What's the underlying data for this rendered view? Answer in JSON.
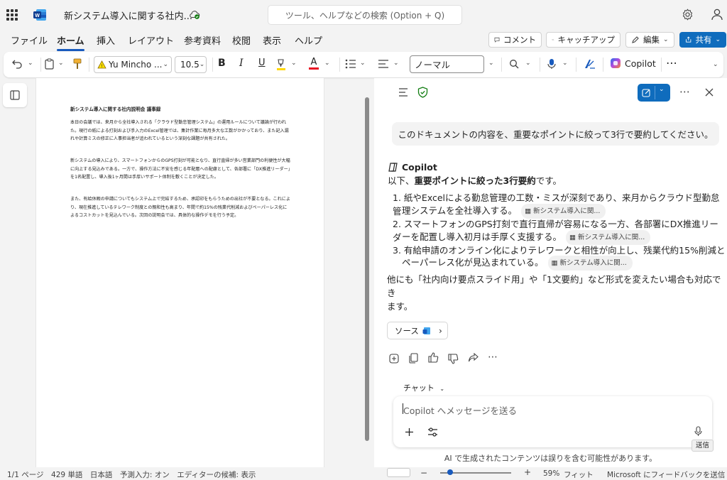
{
  "titlebar": {
    "doc_title": "新システム導入に関する社内...",
    "search_placeholder": "ツール、ヘルプなどの検索 (Option + Q)"
  },
  "menu": {
    "tabs": [
      "ファイル",
      "ホーム",
      "挿入",
      "レイアウト",
      "参考資料",
      "校閲",
      "表示",
      "ヘルプ"
    ],
    "active": "ホーム",
    "comment_label": "コメント",
    "catchup_label": "キャッチアップ",
    "edit_label": "編集",
    "share_label": "共有"
  },
  "ribbon": {
    "font_name": "Yu Mincho ...",
    "font_size": "10.5",
    "style_name": "ノーマル",
    "copilot_label": "Copilot",
    "bold_glyph": "B",
    "italic_glyph": "I",
    "underline_glyph": "U",
    "font_color_glyph": "A"
  },
  "document": {
    "heading": "新システム導入に関する社内説明会 議事録",
    "paragraphs": [
      "本日の会議では、来月から全社導入される「クラウド型勤怠管理システム」の運用ルールについて議論が行われた。現行の紙による打刻および手入力のExcel管理では、集計作業に毎月多大な工数がかかっており、また記入漏れや計算ミスの修正に人事担当者が追われているという深刻な課題が共有された。",
      "新システムの導入により、スマートフォンからのGPS打刻が可能となり、直行直帰が多い営業部門の利便性が大幅に向上する見込みである。一方で、操作方法に不安を感じる年配層への配慮として、各部署に「DX推進リーダー」を1名配置し、導入後1ヶ月間は手厚いサポート体制を敷くことが決定した。",
      "また、有給休暇の申請についてもシステム上で完結するため、承認印をもらうための出社が不要となる。これにより、現在推進しているテレワーク制度との親和性も高まり、年間で約15%の残業代削減およびペーパーレス化によるコストカットを見込んでいる。次回の説明会では、具体的な操作デモを行う予定。"
    ]
  },
  "copilot": {
    "user_message": "このドキュメントの内容を、重要なポイントに絞って3行で要約してください。",
    "name": "Copilot",
    "intro_prefix": "以下、",
    "intro_bold": "重要ポイントに絞った3行要約",
    "intro_suffix": "です。",
    "items": [
      {
        "num": "1.",
        "line1": "紙やExcelによる勤怠管理の工数・ミスが深刻であり、来月からクラウド型勤怠管",
        "line2": "理システムを全社導入する。",
        "cite": "新システム導入に関..."
      },
      {
        "num": "2.",
        "line1": "スマートフォンのGPS打刻で直行直帰が容易になる一方、各部署にDX推進リーダ",
        "line2": "ーを配置し導入初月は手厚く支援する。",
        "cite": "新システム導入に関..."
      },
      {
        "num": "3.",
        "line1": "有給申請のオンライン化によりテレワークと相性が向上し、残業代約15%削減と",
        "line2": "ペーパーレス化が見込まれている。",
        "cite": "新システム導入に関..."
      }
    ],
    "followup_line1": "他にも「社内向け要点スライド用」や「1文要約」など形式を変えたい場合も対応でき",
    "followup_line2": "ます。",
    "sources_label": "ソース",
    "chat_mode": "チャット",
    "input_placeholder": "Copilot へメッセージを送る",
    "send_tooltip": "送信",
    "ai_note": "AI で生成されたコンテンツは誤りを含む可能性があります。"
  },
  "statusbar": {
    "left": "1/1 ページ　429 単語　日本語　予測入力: オン　エディターの候補: 表示",
    "zoom": "59%",
    "fit": "フィット",
    "feedback": "Microsoft にフィードバックを送信"
  },
  "colors": {
    "accent": "#185abd",
    "share_bg": "#0f6cbd",
    "check_green": "#107c10"
  }
}
